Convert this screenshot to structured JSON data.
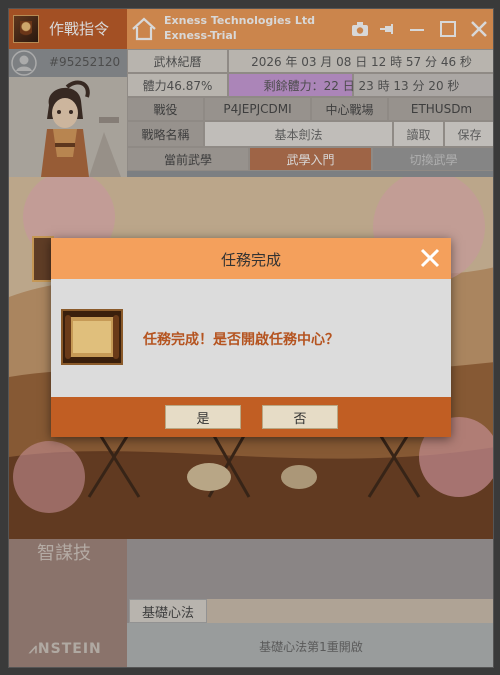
{
  "app": {
    "title": "作戰指令",
    "company_line1": "Exness Technologies Ltd",
    "company_line2": "Exness-Trial",
    "colors": {
      "accent": "#f09a55",
      "dark_accent": "#bf5a24",
      "modal_text": "#b55420"
    }
  },
  "account": {
    "number": "#95252120"
  },
  "info": {
    "record_label": "武林紀曆",
    "datetime": "2026 年 03 月 08 日 12 時 57 分 46 秒",
    "stamina": "體力46.87%",
    "remaining_stamina": "剩餘體力：22 日 23 時 13 分 20 秒",
    "battle_label": "戰役",
    "battle_value": "P4JEPJCDMI",
    "arena_label": "中心戰場",
    "symbol": "ETHUSDm",
    "strategy_label": "戰略名稱",
    "strategy_value": "基本劍法",
    "read_button": "讀取",
    "save_button": "保存"
  },
  "tabs": [
    {
      "label": "當前武學"
    },
    {
      "label": "武學入門"
    },
    {
      "label": "切換武學"
    }
  ],
  "left": {
    "skill_label": "智謀技",
    "brand": "NSTEIN"
  },
  "heart": {
    "tab": "基礎心法",
    "message": "基礎心法第1重開啟"
  },
  "modal": {
    "title": "任務完成",
    "message": "任務完成！是否開啟任務中心？",
    "yes": "是",
    "no": "否"
  },
  "icons": [
    "home-icon",
    "camera-icon",
    "pin-icon",
    "minimize-icon",
    "maximize-icon",
    "close-icon",
    "user-icon",
    "scroll-icon"
  ]
}
